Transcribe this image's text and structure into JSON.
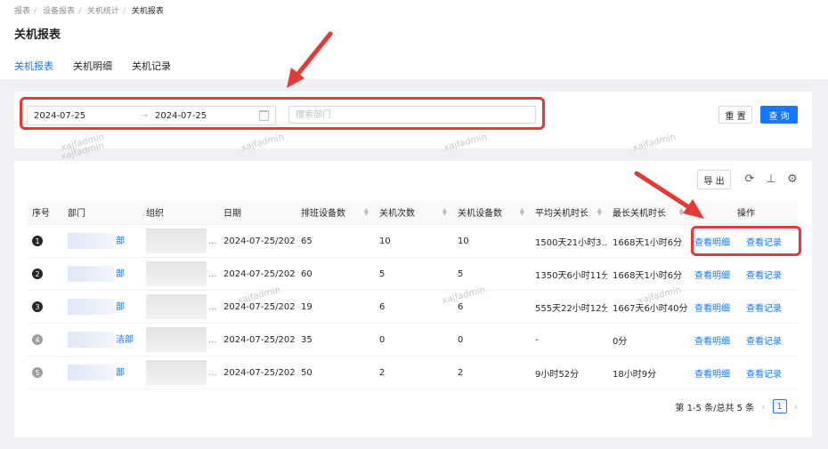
{
  "breadcrumb": [
    "报表",
    "设备报表",
    "关机统计",
    "关机报表"
  ],
  "page_title": "关机报表",
  "tabs": [
    {
      "label": "关机报表",
      "active": true
    },
    {
      "label": "关机明细",
      "active": false
    },
    {
      "label": "关机记录",
      "active": false
    }
  ],
  "filter": {
    "date_start": "2024-07-25",
    "date_end": "2024-07-25",
    "dept_placeholder": "搜索部门",
    "reset_label": "重 置",
    "query_label": "查 询"
  },
  "toolbar": {
    "export_label": "导 出"
  },
  "table": {
    "columns": [
      "序号",
      "部门",
      "组织",
      "日期",
      "排班设备数",
      "关机次数",
      "关机设备数",
      "平均关机时长",
      "最长关机时长",
      "操作"
    ],
    "rows": [
      {
        "no": "1",
        "dept": "部",
        "date": "2024-07-25/202...",
        "scheduled": "65",
        "count": "10",
        "devices": "10",
        "avg": "1500天21小时3...",
        "max": "1668天1小时6分"
      },
      {
        "no": "2",
        "dept": "部",
        "date": "2024-07-25/202...",
        "scheduled": "60",
        "count": "5",
        "devices": "5",
        "avg": "1350天6小时11分",
        "max": "1668天1小时6分"
      },
      {
        "no": "3",
        "dept": "部",
        "date": "2024-07-25/202...",
        "scheduled": "19",
        "count": "6",
        "devices": "6",
        "avg": "555天22小时12分",
        "max": "1667天6小时40分"
      },
      {
        "no": "4",
        "dept": "洁部",
        "date": "2024-07-25/202...",
        "scheduled": "35",
        "count": "0",
        "devices": "0",
        "avg": "-",
        "max": "0分"
      },
      {
        "no": "5",
        "dept": "部",
        "date": "2024-07-25/202...",
        "scheduled": "50",
        "count": "2",
        "devices": "2",
        "avg": "9小时52分",
        "max": "18小时9分"
      }
    ],
    "action_detail": "查看明细",
    "action_record": "查看记录",
    "ellipsis": "..."
  },
  "pagination": {
    "summary": "第 1-5 条/总共 5 条",
    "current": "1",
    "prev": "‹",
    "next": "›"
  },
  "watermark": "xajfadmin",
  "colors": {
    "primary": "#1677ff",
    "annotation": "#e53935"
  }
}
